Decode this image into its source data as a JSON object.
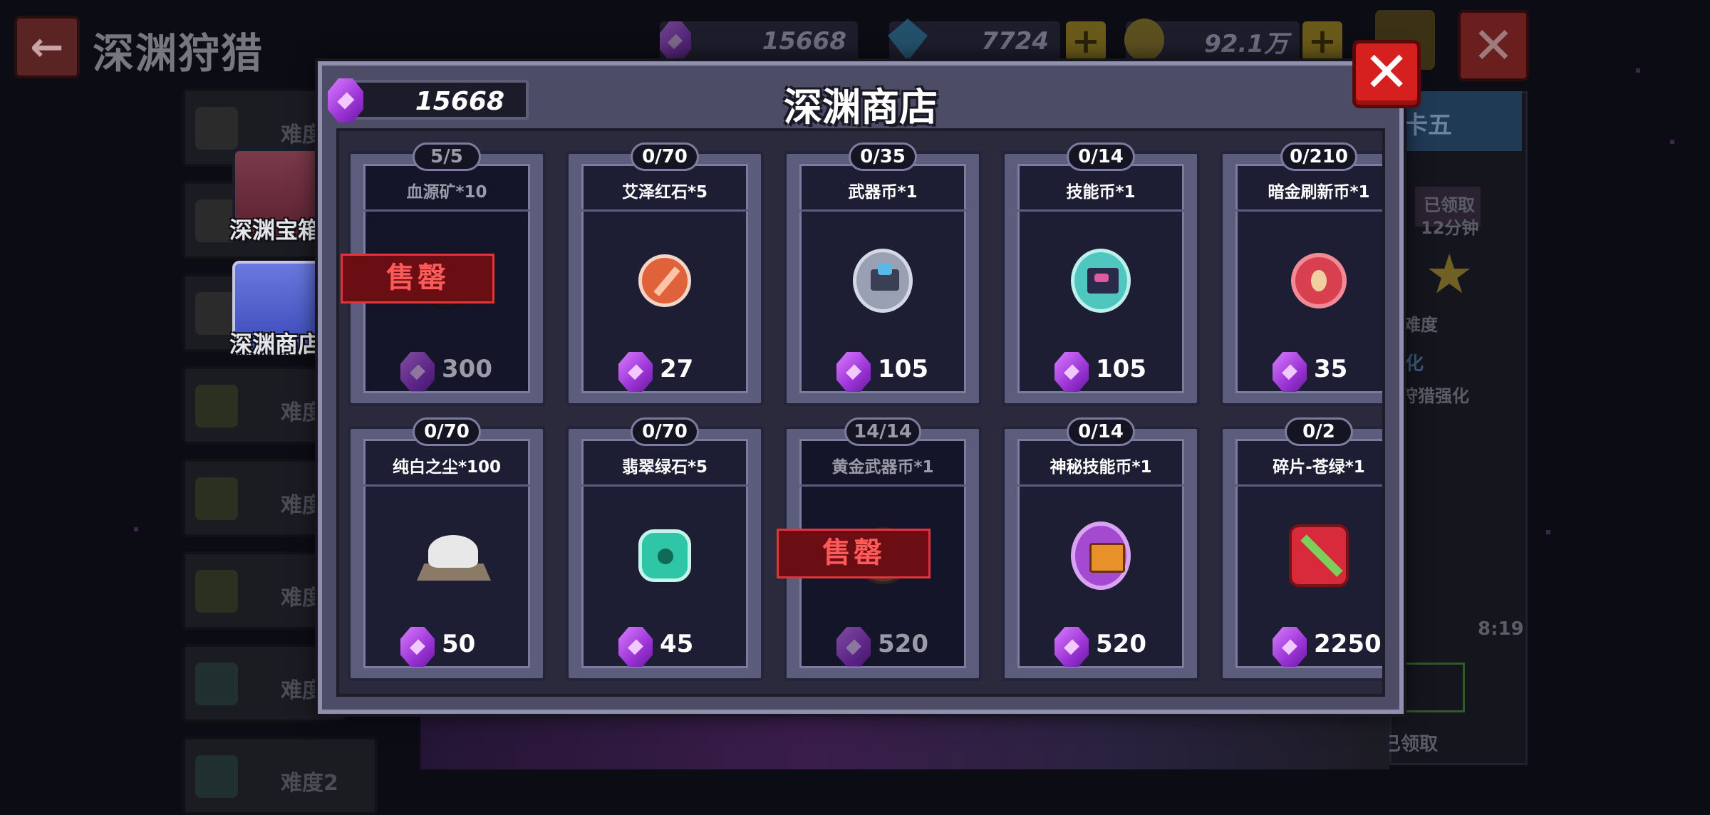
{
  "background": {
    "title": "深渊狩猎",
    "resources": [
      {
        "name": "purple-crystal",
        "value": "15668"
      },
      {
        "name": "blue-gem",
        "value": "7724"
      },
      {
        "name": "gold-coin",
        "value": "92.1万"
      }
    ],
    "difficulty_label": "难度",
    "difficulty_items": [
      "难度",
      "难度",
      "难度",
      "难度",
      "难度",
      "难度",
      "难度",
      "难度2"
    ],
    "side_buttons": [
      {
        "label": "深渊宝箱"
      },
      {
        "label": "深渊商店"
      }
    ],
    "right_panel": {
      "tab_label": "卡五",
      "claimed": "已领取",
      "time": "12分钟",
      "difficulty": "难度",
      "enhance": "化",
      "hunt_enhance": "狩猎强化",
      "timer": "8:19",
      "reward_claimed": "本关奖励已领取"
    }
  },
  "shop": {
    "title": "深渊商店",
    "currency": "15668",
    "sold_out_label": "售罄",
    "items": [
      {
        "count": "5/5",
        "name": "血源矿*10",
        "price": "300",
        "sold_out": true,
        "icon": "blood-ore-icon",
        "color": "#b03030"
      },
      {
        "count": "0/70",
        "name": "艾泽红石*5",
        "price": "27",
        "sold_out": false,
        "icon": "red-stone-icon",
        "color": "#e0623a"
      },
      {
        "count": "0/35",
        "name": "武器币*1",
        "price": "105",
        "sold_out": false,
        "icon": "weapon-coin-icon",
        "color": "#9aa0b4"
      },
      {
        "count": "0/14",
        "name": "技能币*1",
        "price": "105",
        "sold_out": false,
        "icon": "skill-coin-icon",
        "color": "#4fc7c0"
      },
      {
        "count": "0/210",
        "name": "暗金刷新币*1",
        "price": "35",
        "sold_out": false,
        "icon": "refresh-coin-icon",
        "color": "#d84050"
      },
      {
        "count": "0/70",
        "name": "纯白之尘*100",
        "price": "50",
        "sold_out": false,
        "icon": "white-dust-icon",
        "color": "#e8e8e8"
      },
      {
        "count": "0/70",
        "name": "翡翠绿石*5",
        "price": "45",
        "sold_out": false,
        "icon": "emerald-icon",
        "color": "#2fc6a8"
      },
      {
        "count": "14/14",
        "name": "黄金武器币*1",
        "price": "520",
        "sold_out": true,
        "icon": "gold-weapon-coin-icon",
        "color": "#c98a2a"
      },
      {
        "count": "0/14",
        "name": "神秘技能币*1",
        "price": "520",
        "sold_out": false,
        "icon": "mystic-skill-coin-icon",
        "color": "#a44ad0"
      },
      {
        "count": "0/2",
        "name": "碎片-苍绿*1",
        "price": "2250",
        "sold_out": false,
        "icon": "fragment-green-icon",
        "color": "#d82a3a"
      }
    ]
  },
  "colors": {
    "gem": "#b046e6",
    "close": "#d61f1f",
    "sold_out": "#e0343a"
  }
}
